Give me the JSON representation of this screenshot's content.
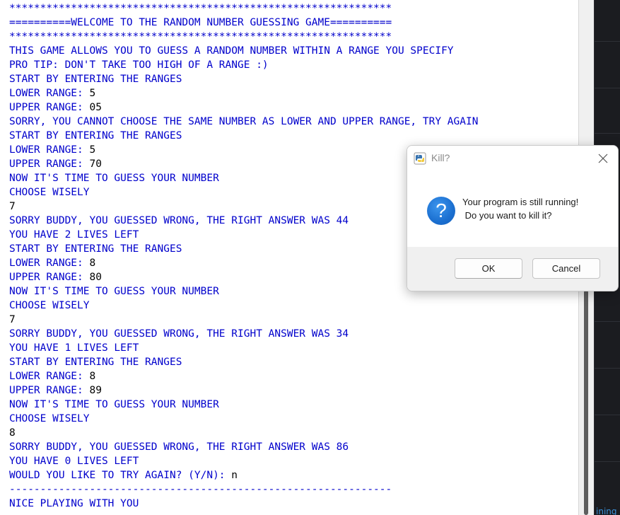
{
  "console": {
    "lines": [
      {
        "text": "**************************************************************",
        "kind": "out"
      },
      {
        "text": "==========WELCOME TO THE RANDOM NUMBER GUESSING GAME==========",
        "kind": "out"
      },
      {
        "text": "**************************************************************",
        "kind": "out"
      },
      {
        "text": "THIS GAME ALLOWS YOU TO GUESS A RANDOM NUMBER WITHIN A RANGE YOU SPECIFY",
        "kind": "out"
      },
      {
        "text": "PRO TIP: DON'T TAKE TOO HIGH OF A RANGE :)",
        "kind": "out"
      },
      {
        "text": "START BY ENTERING THE RANGES",
        "kind": "out"
      },
      {
        "text": "LOWER RANGE: ",
        "kind": "out",
        "input": "5"
      },
      {
        "text": "UPPER RANGE: ",
        "kind": "out",
        "input": "05"
      },
      {
        "text": "SORRY, YOU CANNOT CHOOSE THE SAME NUMBER AS LOWER AND UPPER RANGE, TRY AGAIN",
        "kind": "out"
      },
      {
        "text": "START BY ENTERING THE RANGES",
        "kind": "out"
      },
      {
        "text": "LOWER RANGE: ",
        "kind": "out",
        "input": "5"
      },
      {
        "text": "UPPER RANGE: ",
        "kind": "out",
        "input": "70"
      },
      {
        "text": "NOW IT'S TIME TO GUESS YOUR NUMBER",
        "kind": "out"
      },
      {
        "text": "CHOOSE WISELY",
        "kind": "out"
      },
      {
        "text": "7",
        "kind": "in"
      },
      {
        "text": "SORRY BUDDY, YOU GUESSED WRONG, THE RIGHT ANSWER WAS 44",
        "kind": "out"
      },
      {
        "text": "YOU HAVE 2 LIVES LEFT",
        "kind": "out"
      },
      {
        "text": "START BY ENTERING THE RANGES",
        "kind": "out"
      },
      {
        "text": "LOWER RANGE: ",
        "kind": "out",
        "input": "8"
      },
      {
        "text": "UPPER RANGE: ",
        "kind": "out",
        "input": "80"
      },
      {
        "text": "NOW IT'S TIME TO GUESS YOUR NUMBER",
        "kind": "out"
      },
      {
        "text": "CHOOSE WISELY",
        "kind": "out"
      },
      {
        "text": "7",
        "kind": "in"
      },
      {
        "text": "SORRY BUDDY, YOU GUESSED WRONG, THE RIGHT ANSWER WAS 34",
        "kind": "out"
      },
      {
        "text": "YOU HAVE 1 LIVES LEFT",
        "kind": "out"
      },
      {
        "text": "START BY ENTERING THE RANGES",
        "kind": "out"
      },
      {
        "text": "LOWER RANGE: ",
        "kind": "out",
        "input": "8"
      },
      {
        "text": "UPPER RANGE: ",
        "kind": "out",
        "input": "89"
      },
      {
        "text": "NOW IT'S TIME TO GUESS YOUR NUMBER",
        "kind": "out"
      },
      {
        "text": "CHOOSE WISELY",
        "kind": "out"
      },
      {
        "text": "8",
        "kind": "in"
      },
      {
        "text": "SORRY BUDDY, YOU GUESSED WRONG, THE RIGHT ANSWER WAS 86",
        "kind": "out"
      },
      {
        "text": "YOU HAVE 0 LIVES LEFT",
        "kind": "out"
      },
      {
        "text": "WOULD YOU LIKE TO TRY AGAIN? (Y/N): ",
        "kind": "out",
        "input": "n"
      },
      {
        "text": "--------------------------------------------------------------",
        "kind": "out"
      },
      {
        "text": "NICE PLAYING WITH YOU",
        "kind": "out"
      }
    ]
  },
  "dialog": {
    "title": "Kill?",
    "app_icon": "python-icon",
    "close_icon": "close-icon",
    "message_icon": "question-icon",
    "message_icon_glyph": "?",
    "message_line1": "Your program is still running!",
    "message_line2": " Do you want to kill it?",
    "ok_label": "OK",
    "cancel_label": "Cancel"
  },
  "right_pane": {
    "status_text": "ining"
  },
  "colors": {
    "output_text": "#0000cc",
    "input_text": "#000000",
    "dark_pane": "#1b1c20",
    "status_text": "#3a8fd6",
    "question_icon": "#1b6fd0"
  }
}
